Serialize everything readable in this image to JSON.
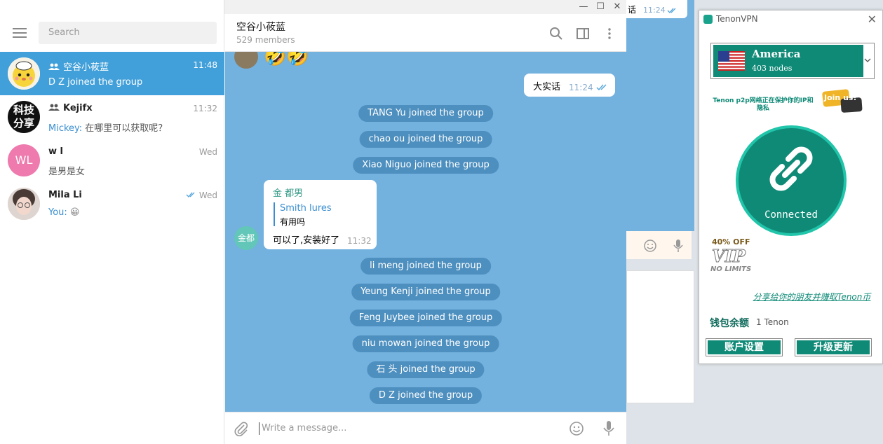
{
  "sidebar": {
    "search_placeholder": "Search",
    "chats": [
      {
        "name": "空谷小莜蓝",
        "time": "11:48",
        "preview": "D Z joined the group",
        "avatar_text": ""
      },
      {
        "name": "Kejifx",
        "time": "11:32",
        "preview_sender": "Mickey:",
        "preview": " 在哪里可以获取呢？",
        "avatar_text": "科技分享"
      },
      {
        "name": "w l",
        "time": "Wed",
        "preview": "是男是女",
        "avatar_text": "WL"
      },
      {
        "name": "Mila Li",
        "time": "Wed",
        "preview_sender": "You:",
        "preview": " 😀",
        "avatar_text": ""
      }
    ]
  },
  "header": {
    "title": "空谷小莜蓝",
    "members": "529 members"
  },
  "messages": {
    "outgoing": {
      "text": "大实话",
      "time": "11:24"
    },
    "service": [
      "TANG Yu joined the group",
      "chao ou joined the group",
      "Xiao Niguo joined the group",
      "li meng joined the group",
      "Yeung Kenji joined the group",
      "Feng Juybee joined the group",
      "niu mowan joined the group",
      "石 头 joined the group",
      "D Z joined the group"
    ],
    "incoming": {
      "sender": "金 都男",
      "avatar_text": "金都",
      "reply_name": "Smith lures",
      "reply_text": "有用吗",
      "text": "可以了,安装好了",
      "time": "11:32"
    },
    "top_emojis": "🤣🤣"
  },
  "composer": {
    "placeholder": "Write a message..."
  },
  "background_window": {
    "time": "11:24",
    "text": "话"
  },
  "vpn": {
    "title": "TenonVPN",
    "country": "America",
    "nodes": "403 nodes",
    "protect_text": "Tenon p2p网络正在保护你的IP和隐私",
    "join_label": "Join us!",
    "status": "Connected",
    "vip_off": "40% OFF",
    "vip_label": "VIP",
    "vip_sub": "NO LIMITS",
    "share": "分享给你的朋友并赚取Tenon币",
    "wallet_label": "钱包余额",
    "wallet_value": "1 Tenon",
    "btn_account": "账户设置",
    "btn_upgrade": "升级更新",
    "accent": "#0f8a77"
  }
}
